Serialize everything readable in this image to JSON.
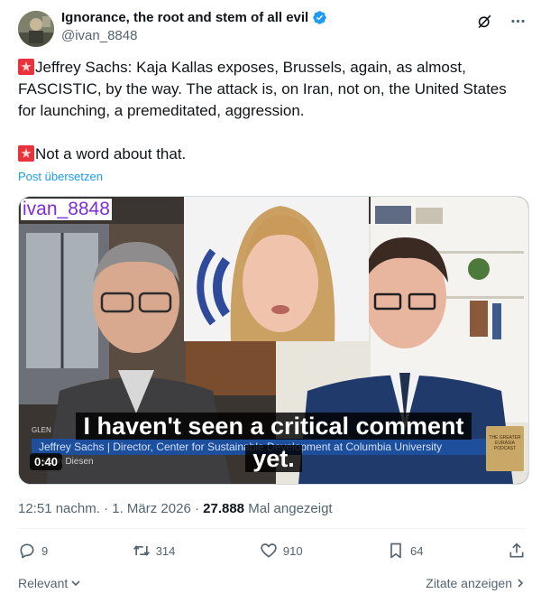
{
  "author": {
    "display_name": "Ignorance, the root and stem of all evil",
    "handle": "@ivan_8848"
  },
  "icons": {
    "verified": "verified-badge-icon",
    "grok": "grok-icon",
    "more": "more-dots-icon",
    "siren": "siren-emoji-icon"
  },
  "tweet": {
    "paragraph1": "Jeffrey Sachs: Kaja Kallas exposes, Brussels, again, as almost, FASCISTIC, by the way. The attack is, on Iran,  not on, the United States for launching, a premeditated, aggression.",
    "paragraph2": "Not a word about that.",
    "translate_link": "Post übersetzen"
  },
  "media": {
    "watermark": "ivan_8848",
    "lower_third_small": "GLEN",
    "lower_third_main": "Jeffrey Sachs | Director, Center for Sustainable Development at Columbia University",
    "lower_third_sub": "Glenn Diesen",
    "subtitle": "I haven't seen a critical comment yet.",
    "duration": "0:40",
    "podcast_logo_text": "THE GREATER EURASIA PODCAST"
  },
  "meta": {
    "time": "12:51 nachm.",
    "separator": " · ",
    "date": "1. März 2026",
    "views_count": "27.888",
    "views_label": "Mal angezeigt"
  },
  "actions": {
    "replies": "9",
    "reposts": "314",
    "likes": "910",
    "bookmarks": "64"
  },
  "bottom": {
    "sort_label": "Relevant",
    "quotes_label": "Zitate anzeigen"
  },
  "colors": {
    "link": "#1d9bf0",
    "secondary_text": "#536471",
    "verified": "#1d9bf0",
    "watermark": "#7b2fd8"
  }
}
